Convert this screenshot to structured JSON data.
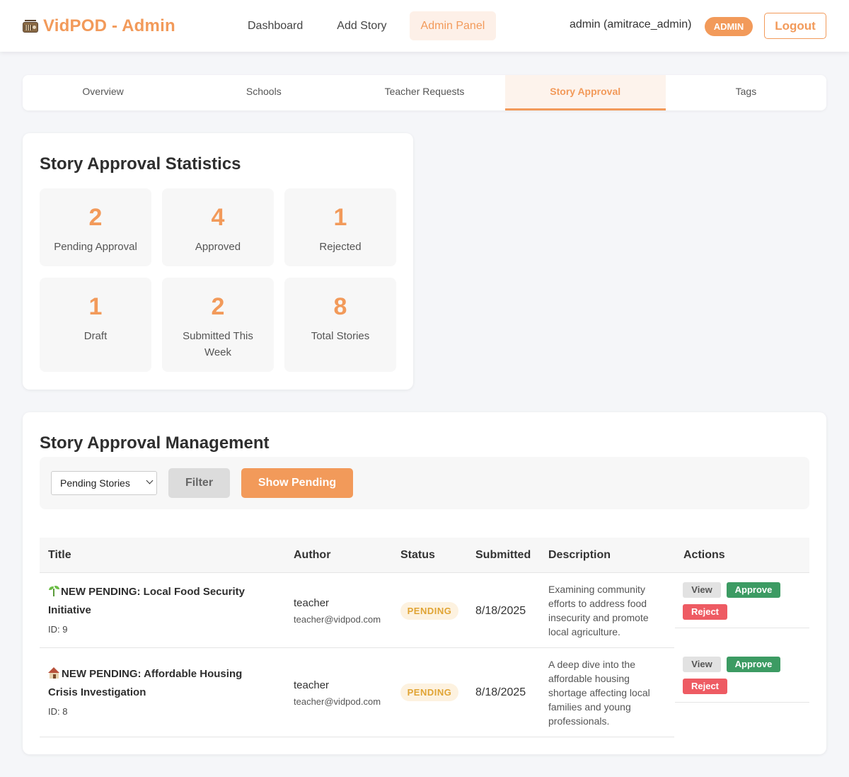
{
  "header": {
    "brand": "VidPOD - Admin",
    "nav": [
      "Dashboard",
      "Add Story",
      "Admin Panel"
    ],
    "user": "admin (amitrace_admin)",
    "badge": "ADMIN",
    "logout": "Logout"
  },
  "tabs": [
    "Overview",
    "Schools",
    "Teacher Requests",
    "Story Approval",
    "Tags"
  ],
  "stats": {
    "title": "Story Approval Statistics",
    "items": [
      {
        "value": "2",
        "label": "Pending Approval"
      },
      {
        "value": "4",
        "label": "Approved"
      },
      {
        "value": "1",
        "label": "Rejected"
      },
      {
        "value": "1",
        "label": "Draft"
      },
      {
        "value": "2",
        "label": "Submitted This Week"
      },
      {
        "value": "8",
        "label": "Total Stories"
      }
    ]
  },
  "management": {
    "title": "Story Approval Management",
    "select_value": "Pending Stories",
    "filter_label": "Filter",
    "show_pending_label": "Show Pending",
    "columns": [
      "Title",
      "Author",
      "Status",
      "Submitted",
      "Description",
      "Actions"
    ],
    "rows": [
      {
        "icon": "seedling-icon",
        "title": "NEW PENDING: Local Food Security Initiative",
        "id": "ID: 9",
        "author": "teacher",
        "email": "teacher@vidpod.com",
        "status": "PENDING",
        "submitted": "8/18/2025",
        "description": "Examining community efforts to address food insecurity and promote local agriculture."
      },
      {
        "icon": "house-icon",
        "title": "NEW PENDING: Affordable Housing Crisis Investigation",
        "id": "ID: 8",
        "author": "teacher",
        "email": "teacher@vidpod.com",
        "status": "PENDING",
        "submitted": "8/18/2025",
        "description": "A deep dive into the affordable housing shortage affecting local families and young professionals."
      }
    ],
    "actions": {
      "view": "View",
      "approve": "Approve",
      "reject": "Reject"
    }
  },
  "colors": {
    "accent": "#f29a5a",
    "approve": "#3c9b63",
    "reject": "#ee5b63",
    "pending": "#e0a434"
  }
}
